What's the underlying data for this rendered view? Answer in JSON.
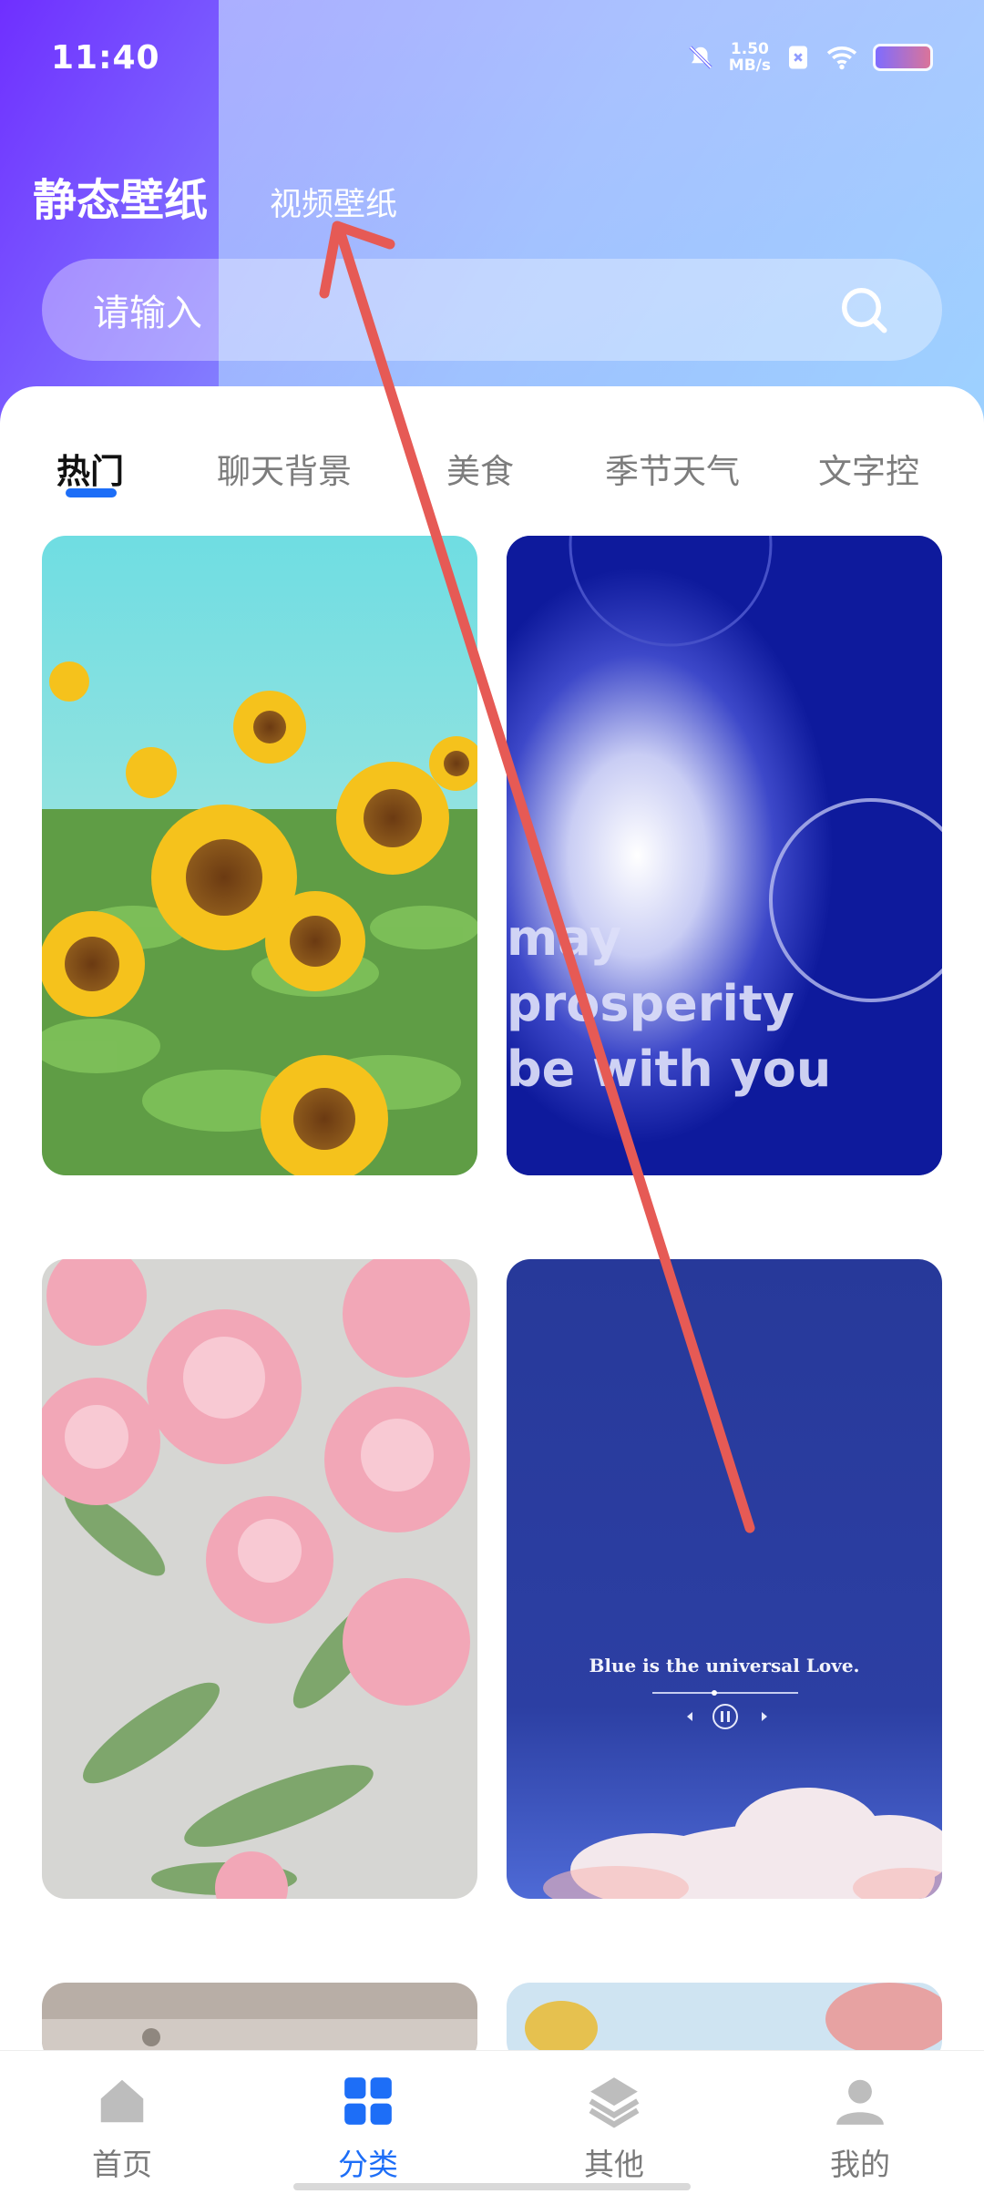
{
  "status": {
    "time": "11:40",
    "net_speed_value": "1.50",
    "net_speed_unit": "MB/s"
  },
  "header": {
    "tab_static": "静态壁纸",
    "tab_video": "视频壁纸"
  },
  "search": {
    "placeholder": "请输入"
  },
  "categories": [
    "热门",
    "聊天背景",
    "美食",
    "季节天气",
    "文字控"
  ],
  "tiles": {
    "tile2_lines": [
      "may",
      "prosperity",
      "be with you"
    ],
    "tile4_caption": "Blue is the universal Love."
  },
  "bottom_nav": {
    "items": [
      "首页",
      "分类",
      "其他",
      "我的"
    ],
    "active": "分类",
    "accent": "#1d6ef7"
  },
  "colors": {
    "accent": "#1d6ef7",
    "annotation_arrow": "#e65a55"
  }
}
